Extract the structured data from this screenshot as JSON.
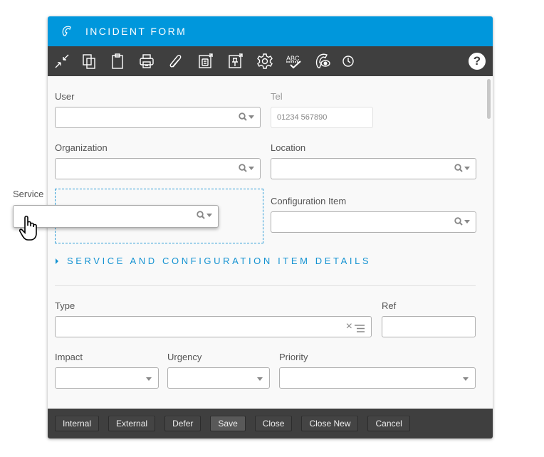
{
  "window": {
    "title": "INCIDENT FORM",
    "title_icon": "phone-icon",
    "accent_color": "#0097dc"
  },
  "toolbar": {
    "icons": [
      "collapse-icon",
      "copy-icon",
      "clipboard-icon",
      "print-icon",
      "attach-icon",
      "export-form-icon",
      "pin-export-icon",
      "settings-icon",
      "spellcheck-icon",
      "watch-call-icon",
      "clock-icon"
    ],
    "help_label": "?"
  },
  "fields": {
    "user": {
      "label": "User",
      "value": ""
    },
    "tel": {
      "label": "Tel",
      "value": "01234 567890"
    },
    "organization": {
      "label": "Organization",
      "value": ""
    },
    "location": {
      "label": "Location",
      "value": ""
    },
    "service": {
      "label": "Service",
      "value": ""
    },
    "configuration_item": {
      "label": "Configuration Item",
      "value": ""
    },
    "type": {
      "label": "Type",
      "value": ""
    },
    "ref": {
      "label": "Ref",
      "value": ""
    },
    "impact": {
      "label": "Impact",
      "value": ""
    },
    "urgency": {
      "label": "Urgency",
      "value": ""
    },
    "priority": {
      "label": "Priority",
      "value": ""
    }
  },
  "section": {
    "label": "SERVICE AND CONFIGURATION ITEM DETAILS"
  },
  "footer": {
    "buttons": [
      "Internal",
      "External",
      "Defer",
      "Save",
      "Close",
      "Close New",
      "Cancel"
    ]
  }
}
